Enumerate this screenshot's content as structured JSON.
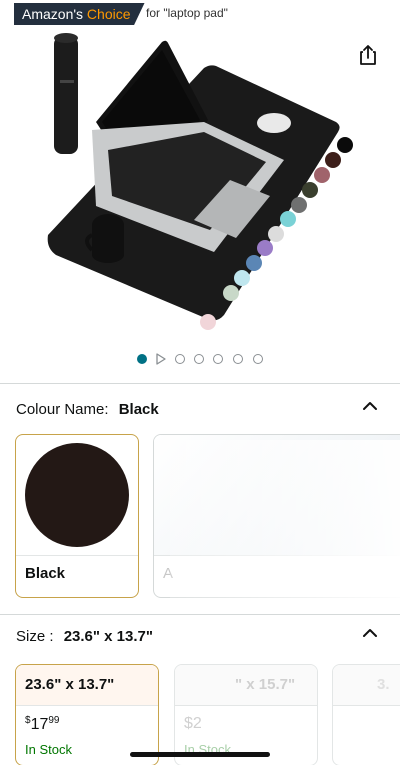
{
  "badge": {
    "prefix": "Amazon's",
    "highlight": "Choice",
    "for_text": "for \"laptop pad\""
  },
  "icons": {
    "share": "share-icon",
    "play": "play-icon",
    "chevron": "chevron-up-icon"
  },
  "carousel": {
    "count": 7,
    "active_index": 0,
    "video_index": 1
  },
  "colour_section": {
    "label": "Colour Name:",
    "value": "Black"
  },
  "colour_swatches": [
    {
      "label": "Black",
      "color": "#231815",
      "selected": true
    },
    {
      "label": "A",
      "selected": false
    }
  ],
  "size_section": {
    "label": "Size :",
    "value": "23.6\" x 13.7\""
  },
  "sizes": [
    {
      "name": "23.6\" x 13.7\"",
      "currency": "$",
      "price_whole": "17",
      "price_cents": "99",
      "stock": "In Stock",
      "selected": true
    },
    {
      "name": "\" x 15.7\"",
      "price_prefix": "$2",
      "stock": "In Stock",
      "selected": false
    },
    {
      "name": "3.",
      "selected": false
    }
  ],
  "colors": {
    "accent_teal": "#007185",
    "selected_border": "#c7a34a",
    "stock_green": "#007600",
    "badge_bg": "#232f3e",
    "badge_orange": "#ff9900",
    "palette_dots": [
      "#0b0b0b",
      "#3d1f1a",
      "#a0636b",
      "#3a3f2e",
      "#6f7070",
      "#7ad2d6",
      "#dcdcdc",
      "#9a7cc7",
      "#5b86b5",
      "#bfe6ee",
      "#c8d8c8",
      "#f1d5d9"
    ]
  }
}
